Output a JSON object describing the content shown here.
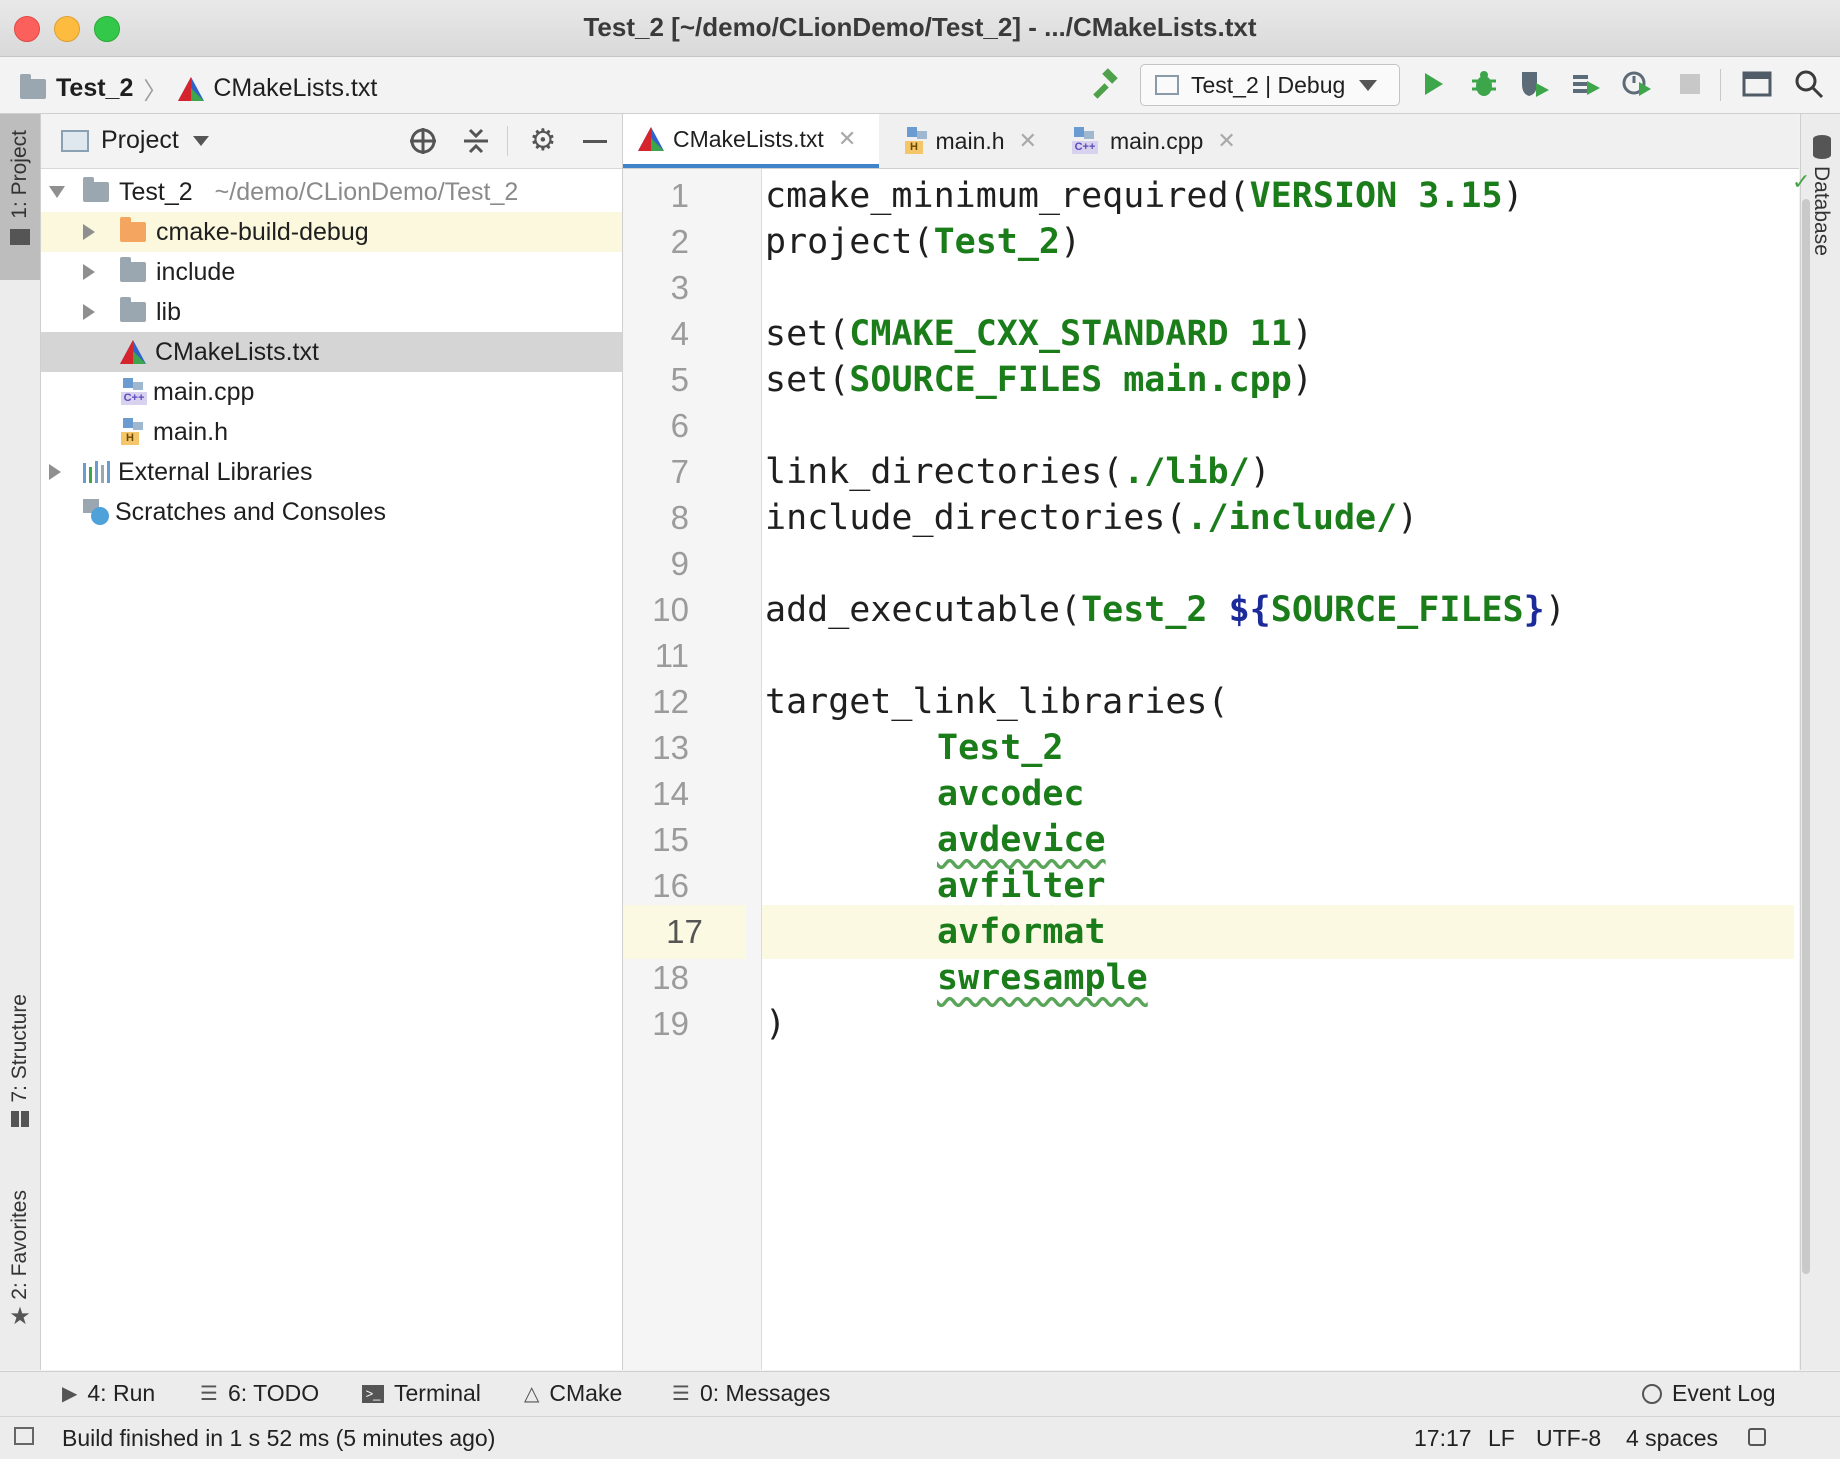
{
  "window": {
    "title": "Test_2 [~/demo/CLionDemo/Test_2] - .../CMakeLists.txt"
  },
  "navbar": {
    "breadcrumb": [
      "Test_2",
      "CMakeLists.txt"
    ],
    "run_config": "Test_2 | Debug",
    "icons": [
      "hammer-icon",
      "run-icon",
      "debug-icon",
      "coverage-icon",
      "profile-icon",
      "attach-icon",
      "stop-icon",
      "layout-icon",
      "search-icon"
    ]
  },
  "left_strip": {
    "tabs": [
      "1: Project",
      "7: Structure",
      "2: Favorites"
    ]
  },
  "right_strip": {
    "tabs": [
      "Database"
    ]
  },
  "project_panel": {
    "title": "Project",
    "root": {
      "name": "Test_2",
      "path": "~/demo/CLionDemo/Test_2"
    },
    "items": [
      {
        "label": "cmake-build-debug",
        "type": "folder-orange"
      },
      {
        "label": "include",
        "type": "folder"
      },
      {
        "label": "lib",
        "type": "folder"
      },
      {
        "label": "CMakeLists.txt",
        "type": "cmake",
        "selected": true
      },
      {
        "label": "main.cpp",
        "type": "cpp"
      },
      {
        "label": "main.h",
        "type": "h"
      }
    ],
    "external": "External Libraries",
    "scratches": "Scratches and Consoles"
  },
  "editor": {
    "tabs": [
      {
        "label": "CMakeLists.txt",
        "active": true,
        "icon": "cmake-icon"
      },
      {
        "label": "main.h",
        "active": false,
        "icon": "h-file-icon"
      },
      {
        "label": "main.cpp",
        "active": false,
        "icon": "cpp-file-icon"
      }
    ],
    "current_line": 17,
    "line_numbers": [
      "1",
      "2",
      "3",
      "4",
      "5",
      "6",
      "7",
      "8",
      "9",
      "10",
      "11",
      "12",
      "13",
      "14",
      "15",
      "16",
      "17",
      "18",
      "19"
    ],
    "lines": {
      "l1": {
        "a": "cmake_minimum_required(",
        "b": "VERSION 3.15",
        "c": ")"
      },
      "l2": {
        "a": "project(",
        "b": "Test_2",
        "c": ")"
      },
      "l4": {
        "a": "set(",
        "b": "CMAKE_CXX_STANDARD 11",
        "c": ")"
      },
      "l5": {
        "a": "set(",
        "b": "SOURCE_FILES main.cpp",
        "c": ")"
      },
      "l7": {
        "a": "link_directories(",
        "b": "./lib/",
        "c": ")"
      },
      "l8": {
        "a": "include_directories(",
        "b": "./include/",
        "c": ")"
      },
      "l10": {
        "a": "add_executable(",
        "b": "Test_2 ",
        "v1": "${",
        "b2": "SOURCE_FILES",
        "v2": "}",
        "c": ")"
      },
      "l12": {
        "a": "target_link_libraries("
      },
      "l13": {
        "b": "Test_2"
      },
      "l14": {
        "b": "avcodec"
      },
      "l15": {
        "b": "avdevice"
      },
      "l16": {
        "b": "avfilter"
      },
      "l17": {
        "b": "avformat"
      },
      "l18": {
        "b": "swresample"
      },
      "l19": {
        "a": ")"
      }
    }
  },
  "toolwindows": {
    "items": [
      {
        "label": "4: Run",
        "icon": "run-icon"
      },
      {
        "label": "6: TODO",
        "icon": "todo-icon"
      },
      {
        "label": "Terminal",
        "icon": "terminal-icon"
      },
      {
        "label": "CMake",
        "icon": "cmake-icon"
      },
      {
        "label": "0: Messages",
        "icon": "messages-icon"
      }
    ],
    "event_log": "Event Log"
  },
  "status": {
    "message": "Build finished in 1 s 52 ms (5 minutes ago)",
    "position": "17:17",
    "line_sep": "LF",
    "encoding": "UTF-8",
    "indent": "4 spaces"
  },
  "colors": {
    "keyword_green": "#1a7d1a",
    "variable_blue": "#1c2b9a",
    "tab_accent": "#4083c9",
    "current_line": "#fcf9e3"
  }
}
